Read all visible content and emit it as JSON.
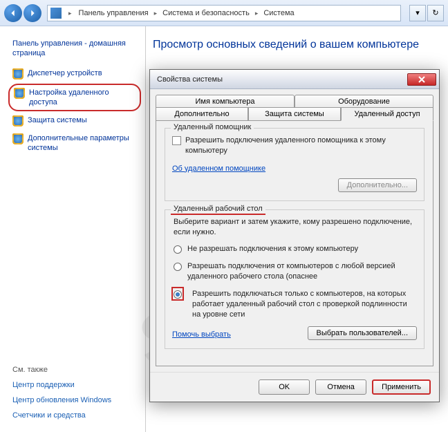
{
  "breadcrumb": {
    "parts": [
      "Панель управления",
      "Система и безопасность",
      "Система"
    ]
  },
  "sidebar": {
    "home": "Панель управления - домашняя страница",
    "items": [
      "Диспетчер устройств",
      "Настройка удаленного доступа",
      "Защита системы",
      "Дополнительные параметры системы"
    ],
    "see_also_title": "См. также",
    "see_also": [
      "Центр поддержки",
      "Центр обновления Windows",
      "Счетчики и средства"
    ]
  },
  "content": {
    "heading": "Просмотр основных сведений о вашем компьютере"
  },
  "dialog": {
    "title": "Свойства системы",
    "tabs_back": [
      "Имя компьютера",
      "Оборудование"
    ],
    "tabs_front": [
      "Дополнительно",
      "Защита системы",
      "Удаленный доступ"
    ],
    "remote_assist": {
      "legend": "Удаленный помощник",
      "checkbox": "Разрешить подключения удаленного помощника к этому компьютеру",
      "link": "Об удаленном помощнике",
      "advanced_btn": "Дополнительно..."
    },
    "remote_desktop": {
      "legend": "Удаленный рабочий стол",
      "desc": "Выберите вариант и затем укажите, кому разрешено подключение, если нужно.",
      "opt1": "Не разрешать подключения к этому компьютеру",
      "opt2": "Разрешать подключения от компьютеров с любой версией удаленного рабочего стола (опаснее",
      "opt3": "Разрешить подключаться только с компьютеров, на которых работает удаленный рабочий стол с проверкой подлинности на уровне сети",
      "help_link": "Помочь выбрать",
      "select_users_btn": "Выбрать пользователей..."
    },
    "footer": {
      "ok": "OK",
      "cancel": "Отмена",
      "apply": "Применить"
    }
  }
}
